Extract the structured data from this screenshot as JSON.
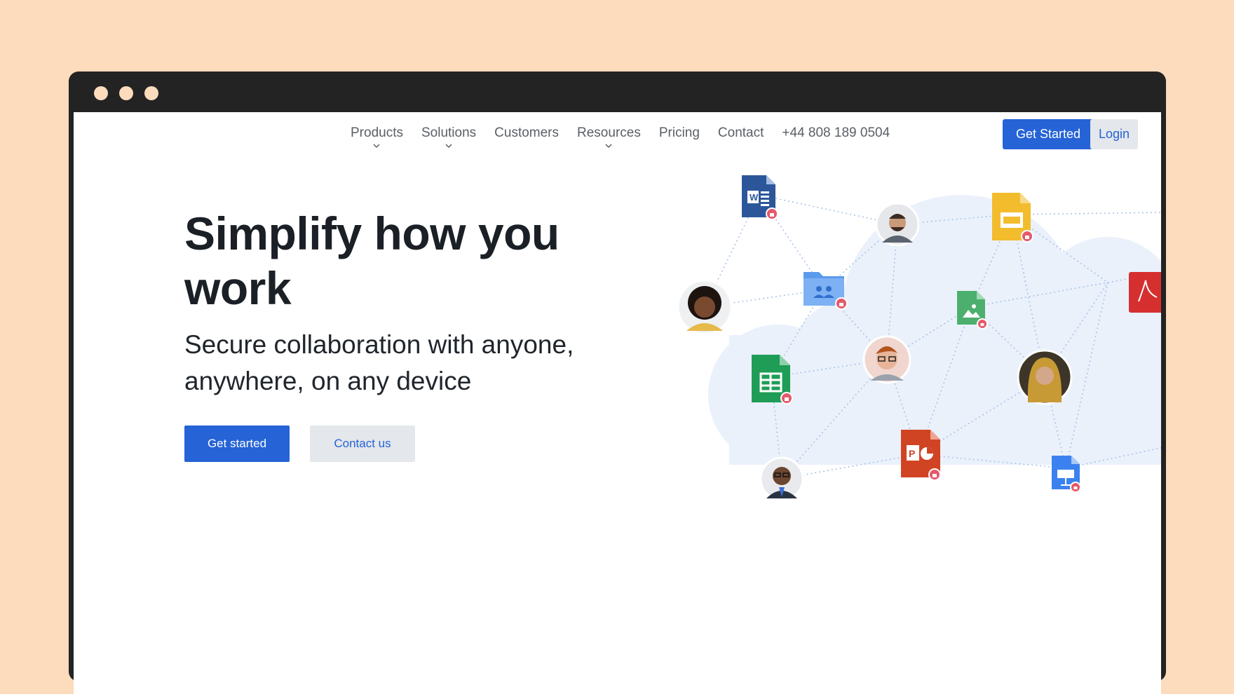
{
  "nav": {
    "items": [
      {
        "label": "Products",
        "has_dropdown": true
      },
      {
        "label": "Solutions",
        "has_dropdown": true
      },
      {
        "label": "Customers",
        "has_dropdown": false
      },
      {
        "label": "Resources",
        "has_dropdown": true
      },
      {
        "label": "Pricing",
        "has_dropdown": false
      },
      {
        "label": "Contact",
        "has_dropdown": false
      },
      {
        "label": "+44 808 189 0504",
        "has_dropdown": false
      }
    ],
    "get_started_label": "Get Started",
    "login_label": "Login"
  },
  "hero": {
    "title": "Simplify how you work",
    "subtitle": "Secure collaboration with anyone, anywhere, on any device",
    "primary_cta": "Get started",
    "secondary_cta": "Contact us"
  },
  "illustration": {
    "icons": [
      "word-doc-icon",
      "slides-doc-icon",
      "folder-shared-icon",
      "image-doc-icon",
      "sheets-doc-icon",
      "powerpoint-doc-icon",
      "keynote-doc-icon",
      "pdf-doc-icon",
      "lock-badge-icon"
    ],
    "avatars": [
      "avatar-man-beard",
      "avatar-woman-curly",
      "avatar-man-glasses",
      "avatar-woman-hijab",
      "avatar-man-suit"
    ]
  },
  "colors": {
    "page_bg": "#fddbbd",
    "frame": "#232323",
    "accent": "#2563d6",
    "secondary_bg": "#e4e7eb",
    "cloud": "#eaf1fb"
  }
}
